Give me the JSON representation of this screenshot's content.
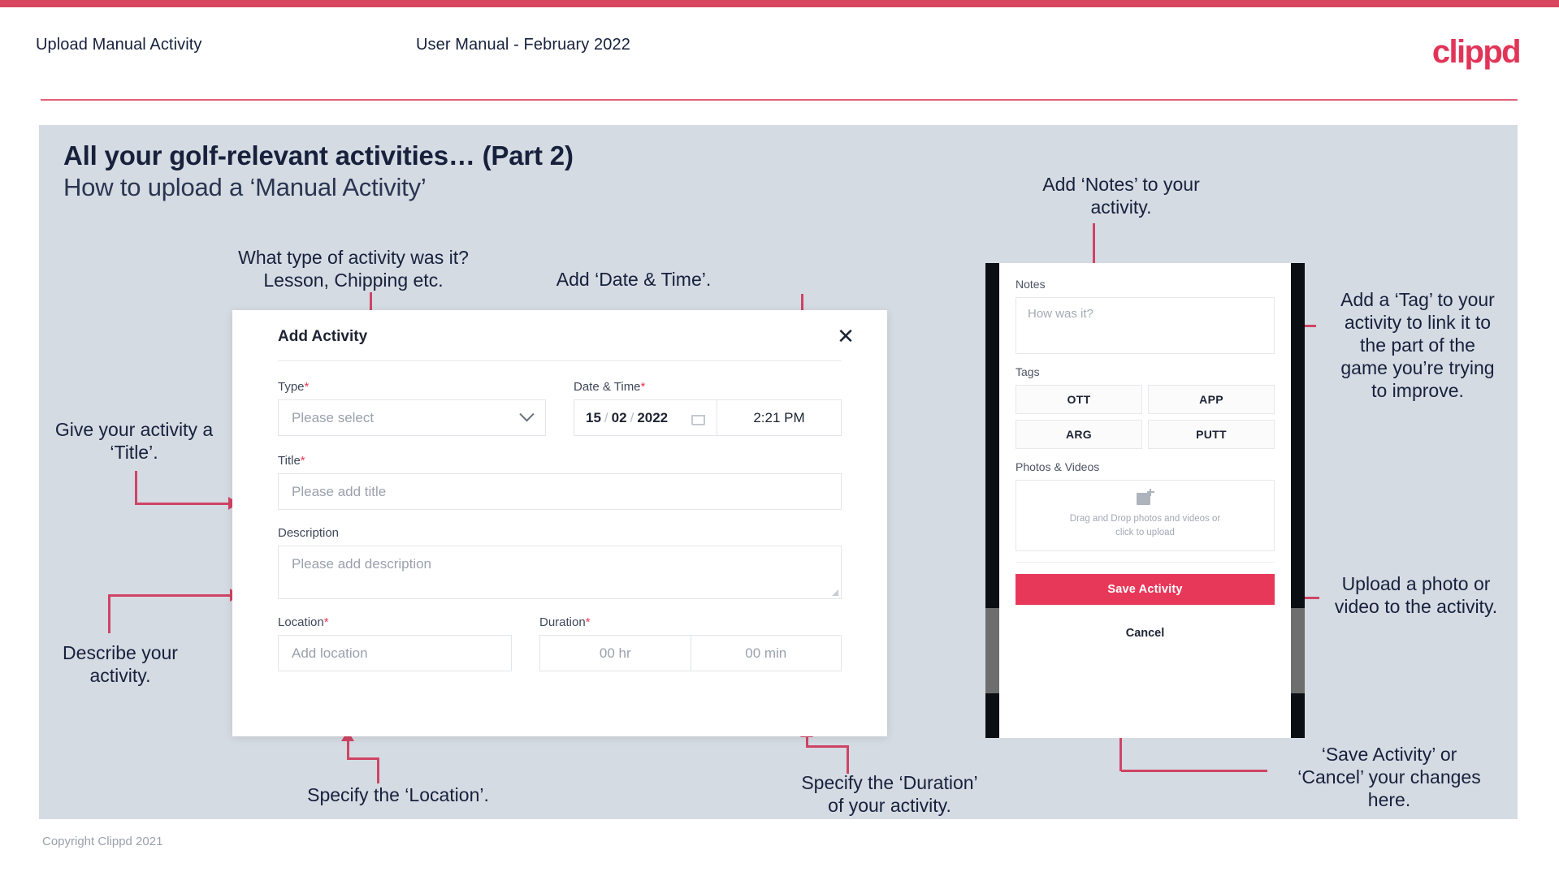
{
  "header": {
    "title": "Upload Manual Activity",
    "subtitle": "User Manual - February 2022",
    "logo": "clippd"
  },
  "slide": {
    "title": "All your golf-relevant activities… (Part 2)",
    "subtitle": "How to upload a ‘Manual Activity’"
  },
  "footer": {
    "copyright": "Copyright Clippd 2021"
  },
  "annotations": {
    "type": "What type of activity was it?\nLesson, Chipping etc.",
    "datetime": "Add ‘Date & Time’.",
    "title_field": "Give your activity a\n‘Title’.",
    "description": "Describe your\nactivity.",
    "location": "Specify the ‘Location’.",
    "duration": "Specify the ‘Duration’\nof your activity.",
    "notes": "Add ‘Notes’ to your\nactivity.",
    "tag": "Add a ‘Tag’ to your\nactivity to link it to\nthe part of the\ngame you’re trying\nto improve.",
    "upload": "Upload a photo or\nvideo to the activity.",
    "save_cancel": "‘Save Activity’ or\n‘Cancel’ your changes\nhere."
  },
  "dialog": {
    "title": "Add Activity",
    "close_icon": "close-icon",
    "fields": {
      "type": {
        "label": "Type",
        "required": "*",
        "placeholder": "Please select"
      },
      "datetime": {
        "label": "Date & Time",
        "required": "*",
        "day": "15",
        "month": "02",
        "year": "2022",
        "sep": "/",
        "time": "2:21 PM"
      },
      "title": {
        "label": "Title",
        "required": "*",
        "placeholder": "Please add title"
      },
      "description": {
        "label": "Description",
        "placeholder": "Please add description"
      },
      "location": {
        "label": "Location",
        "required": "*",
        "placeholder": "Add location"
      },
      "duration": {
        "label": "Duration",
        "required": "*",
        "hours": "00 hr",
        "minutes": "00 min"
      }
    }
  },
  "phone": {
    "notes": {
      "label": "Notes",
      "placeholder": "How was it?"
    },
    "tags": {
      "label": "Tags",
      "items": [
        "OTT",
        "APP",
        "ARG",
        "PUTT"
      ]
    },
    "photos": {
      "label": "Photos & Videos",
      "dropzone_line1": "Drag and Drop photos and videos or",
      "dropzone_line2": "click to upload"
    },
    "save_label": "Save Activity",
    "cancel_label": "Cancel"
  },
  "colors": {
    "brand": "#e23457",
    "accent_line": "#cf4464",
    "slide_bg": "#d5dbe3",
    "text_dark": "#17213c",
    "save_button": "#e8385a"
  }
}
